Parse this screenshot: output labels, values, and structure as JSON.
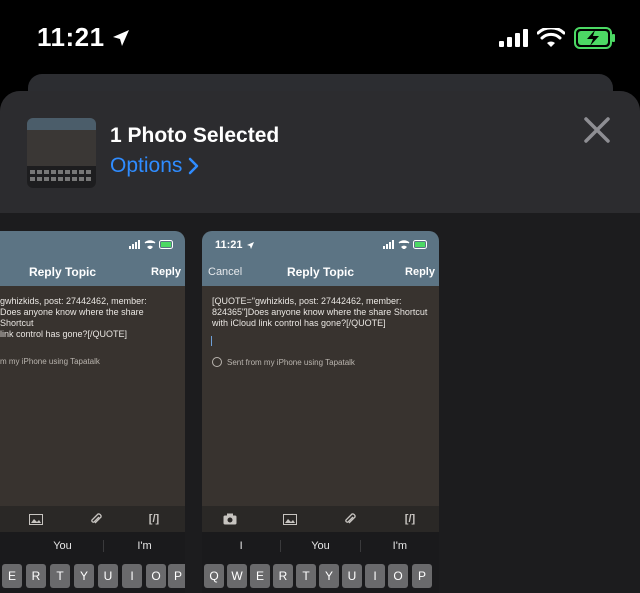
{
  "status_bar": {
    "time": "11:21",
    "icons": [
      "location-arrow-icon",
      "cellular-signal-icon",
      "wifi-icon",
      "battery-charging-icon"
    ],
    "battery_color": "#4cd964"
  },
  "share_sheet": {
    "title": "1 Photo Selected",
    "options_label": "Options",
    "accent_color": "#2f8cff",
    "close_icon": "close-icon"
  },
  "preview_cards": [
    {
      "status_time": "",
      "cancel_label": "",
      "title": "Reply Topic",
      "reply_label": "Reply",
      "body_lines": [
        "gwhizkids, post: 27442462, member:",
        "Does anyone know where the share Shortcut",
        "link control has gone?[/QUOTE]"
      ],
      "signature": "m my iPhone using Tapatalk",
      "toolbar": [
        "image-icon",
        "attachment-icon",
        "[/]"
      ],
      "suggestions": [
        "",
        "You",
        "I'm"
      ],
      "keys": [
        "E",
        "R",
        "T",
        "Y",
        "U",
        "I",
        "O",
        "P"
      ]
    },
    {
      "status_time": "11:21",
      "cancel_label": "Cancel",
      "title": "Reply Topic",
      "reply_label": "Reply",
      "body_lines": [
        "[QUOTE=\"gwhizkids, post: 27442462, member:",
        "824365\"]Does anyone know where the share Shortcut",
        "with iCloud link control has gone?[/QUOTE]"
      ],
      "signature": "Sent from my iPhone using Tapatalk",
      "toolbar": [
        "camera-icon",
        "image-icon",
        "attachment-icon",
        "[/]"
      ],
      "suggestions": [
        "I",
        "You",
        "I'm"
      ],
      "keys": [
        "Q",
        "W",
        "E",
        "R",
        "T",
        "Y",
        "U",
        "I",
        "O",
        "P"
      ]
    }
  ]
}
